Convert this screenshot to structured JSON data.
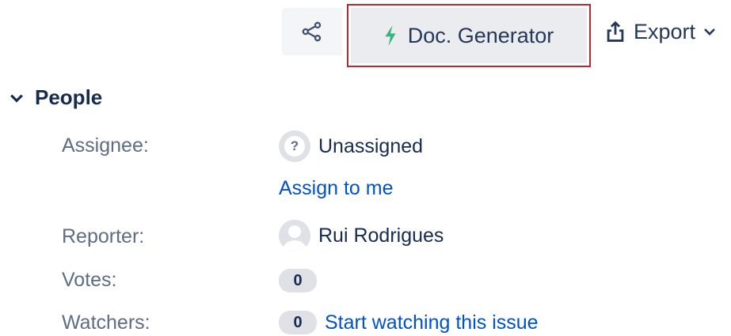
{
  "toolbar": {
    "share_icon": "share-icon",
    "docgen_label": "Doc. Generator",
    "docgen_icon": "lightning-bolt-icon",
    "docgen_icon_color": "#36b37e",
    "export_label": "Export",
    "export_icon": "export-upload-icon",
    "highlight_color": "#c0272d"
  },
  "people": {
    "title": "People",
    "assignee_label": "Assignee:",
    "assignee_value": "Unassigned",
    "assign_to_me": "Assign to me",
    "reporter_label": "Reporter:",
    "reporter_value": "Rui Rodrigues",
    "votes_label": "Votes:",
    "votes_count": "0",
    "watchers_label": "Watchers:",
    "watchers_count": "0",
    "watch_link": "Start watching this issue"
  },
  "colors": {
    "link": "#0052cc",
    "label": "#5e6c84",
    "text": "#172b4d"
  }
}
